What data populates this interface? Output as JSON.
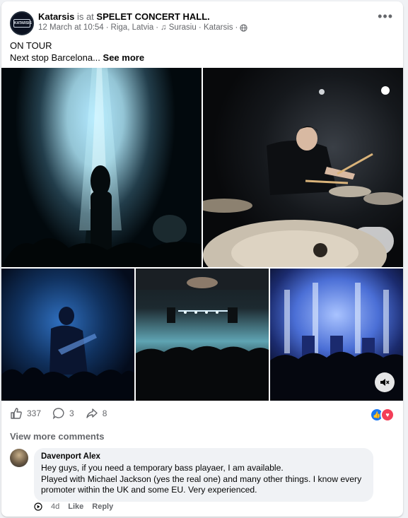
{
  "post": {
    "author": "Katarsis",
    "is_at": "is at",
    "place": "SPELET CONCERT HALL.",
    "date": "12 March at 10:54",
    "location": "Riga, Latvia",
    "song": "Surasiu · Katarsis",
    "caption_line1": "ON TOUR",
    "caption_line2": "Next stop Barcelona...",
    "see_more": "See more",
    "avatar_text": "KATARSIS"
  },
  "stats": {
    "likes": "337",
    "comments": "3",
    "shares": "8"
  },
  "comments": {
    "view_more": "View more comments",
    "items": [
      {
        "author": "Davenport Alex",
        "text_line1": "Hey guys, if you need a temporary bass playaer, I am available.",
        "text_line2": "Played with Michael Jackson (yes the real one) and many other things. I know every promoter within the UK and some EU. Very experienced.",
        "time": "4d",
        "like": "Like",
        "reply": "Reply"
      }
    ]
  },
  "icons": {
    "globe": "globe-icon",
    "music": "music-note-icon",
    "like": "thumbs-up-icon",
    "comment": "comment-icon",
    "share": "share-icon",
    "mute": "speaker-muted-icon",
    "more": "more-dots-icon"
  },
  "colors": {
    "like_blue": "#1877f2",
    "love_red": "#f33e58",
    "meta_grey": "#65676b"
  }
}
